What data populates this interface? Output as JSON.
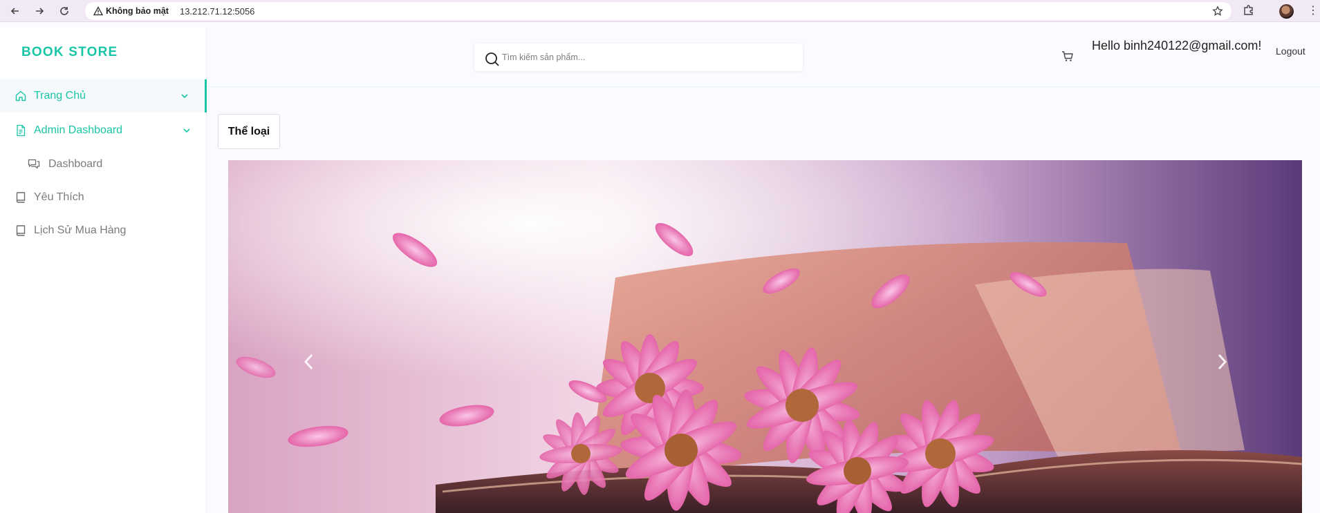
{
  "browser": {
    "security_label": "Không bảo mật",
    "url": "13.212.71.12:5056"
  },
  "sidebar": {
    "brand": "BOOK STORE",
    "items": [
      {
        "label": "Trang Chủ",
        "icon": "home-icon"
      },
      {
        "label": "Admin Dashboard",
        "icon": "document-icon"
      },
      {
        "label": "Dashboard",
        "icon": "chat-icon"
      },
      {
        "label": "Yêu Thích",
        "icon": "book-icon"
      },
      {
        "label": "Lịch Sử Mua Hàng",
        "icon": "book-icon"
      }
    ]
  },
  "header": {
    "search_placeholder": "Tìm kiếm sản phẩm...",
    "greeting": "Hello binh240122@gmail.com!",
    "logout": "Logout"
  },
  "main": {
    "category_button": "Thể loại"
  },
  "colors": {
    "accent": "#18c6a6"
  }
}
